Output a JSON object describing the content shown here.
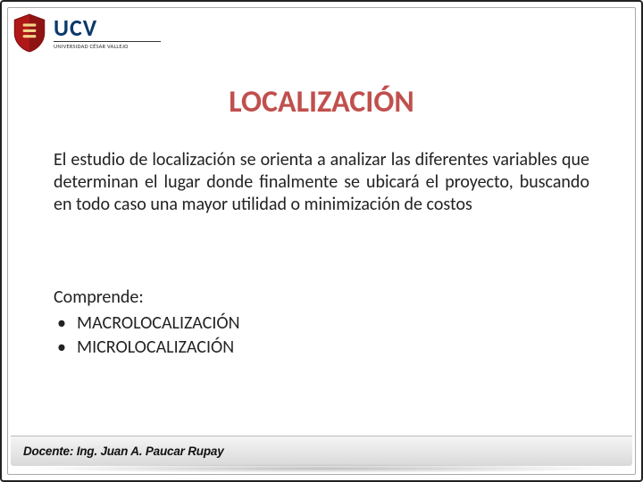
{
  "logo": {
    "main": "UCV",
    "sub": "UNIVERSIDAD CÉSAR VALLEJO"
  },
  "title": "LOCALIZACIÓN",
  "paragraph": "El estudio de localización se orienta a analizar las diferentes variables que determinan el lugar donde finalmente se ubicará el proyecto, buscando en todo caso una mayor utilidad o minimización de costos",
  "list": {
    "heading": "Comprende:",
    "items": [
      "MACROLOCALIZACIÓN",
      "MICROLOCALIZACIÓN"
    ]
  },
  "footer": {
    "label": "Docente: Ing. Juan A. Paucar Rupay"
  }
}
